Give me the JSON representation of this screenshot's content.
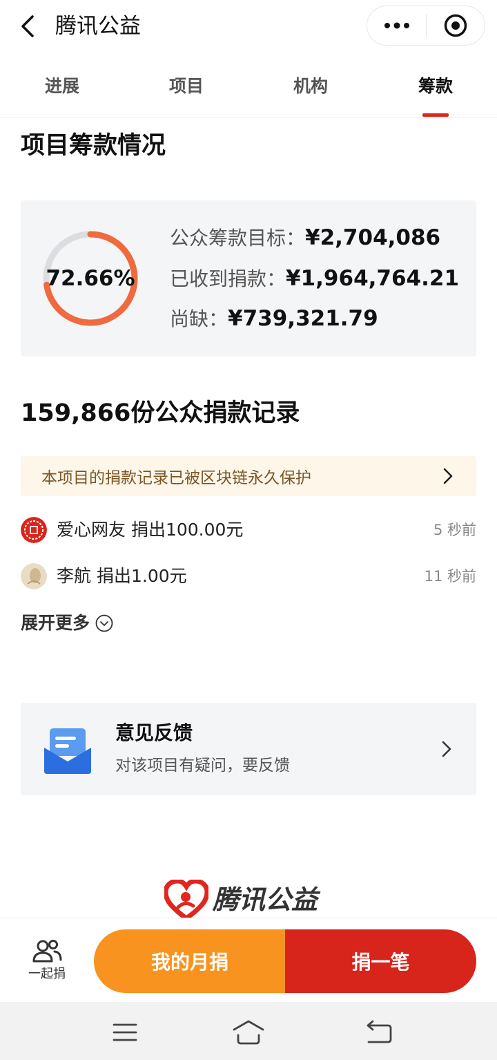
{
  "header": {
    "title": "腾讯公益",
    "back_icon": "chevron-left-icon",
    "more_icon": "more-dots-icon",
    "close_icon": "target-close-icon"
  },
  "tabs": [
    {
      "label": "进展",
      "active": false
    },
    {
      "label": "项目",
      "active": false
    },
    {
      "label": "机构",
      "active": false
    },
    {
      "label": "筹款",
      "active": true
    }
  ],
  "fundraising": {
    "section_title": "项目筹款情况",
    "progress_label": "72.66%",
    "progress_fraction": 0.7266,
    "goal_label": "公众筹款目标：",
    "goal_value": "¥2,704,086",
    "received_label": "已收到捐款：",
    "received_value": "¥1,964,764.21",
    "shortfall_label": "尚缺：",
    "shortfall_value": "¥739,321.79",
    "colors": {
      "ring_fill": "#ef6a3f",
      "ring_track": "#dcdde0"
    }
  },
  "records": {
    "title": "159,866份公众捐款记录",
    "chain_notice": "本项目的捐款记录已被区块链永久保护",
    "items": [
      {
        "name": "爱心网友",
        "action": "捐出100.00元",
        "time": "5 秒前",
        "avatar_icon": "red-fortune-avatar-icon"
      },
      {
        "name": "李航",
        "action": "捐出1.00元",
        "time": "11 秒前",
        "avatar_icon": "beige-photo-avatar-icon"
      }
    ],
    "expand_label": "展开更多"
  },
  "feedback": {
    "title": "意见反馈",
    "subtitle": "对该项目有疑问，要反馈",
    "icon": "feedback-envelope-icon"
  },
  "logo": {
    "text": "腾讯公益",
    "icon": "heart-logo-icon",
    "color": "#e0261f"
  },
  "bottom_bar": {
    "together_label": "一起捐",
    "monthly_label": "我的月捐",
    "donate_label": "捐一笔",
    "colors": {
      "monthly": "#f7931e",
      "donate": "#d8251c"
    }
  },
  "system_nav": {
    "menu_icon": "menu-lines-icon",
    "home_icon": "home-icon",
    "back_icon": "return-icon"
  }
}
